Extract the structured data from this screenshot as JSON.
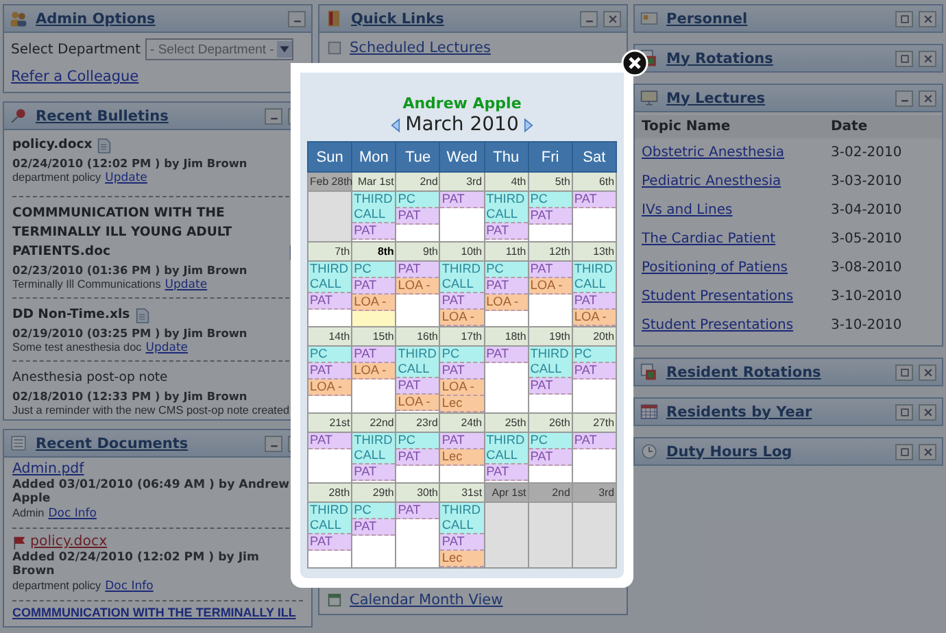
{
  "left": [
    {
      "kind": "admin",
      "title": "Admin Options",
      "expanded": true,
      "closable": false,
      "field_label": "Select Department",
      "select_value": "- Select Department -",
      "link": "Refer a Colleague"
    },
    {
      "kind": "bulletins",
      "title": "Recent Bulletins",
      "expanded": true,
      "closable": true,
      "items": [
        {
          "kind": "file",
          "title": "policy.docx",
          "meta": "02/24/2010 (12:02 PM ) by Jim Brown",
          "desc": "department policy",
          "link": "Update"
        },
        {
          "kind": "file",
          "title": "COMMMUNICATION WITH THE TERMINALLY ILL YOUNG ADULT PATIENTS.doc",
          "meta": "02/23/2010 (01:36 PM ) by Jim Brown",
          "desc": "Terminally Ill Communications",
          "link": "Update"
        },
        {
          "kind": "file",
          "title": "DD Non-Time.xls",
          "meta": "02/19/2010 (03:25 PM ) by Jim Brown",
          "desc": "Some test anesthesia doc",
          "link": "Update"
        },
        {
          "kind": "note",
          "title": "Anesthesia post-op note",
          "meta": "02/18/2010 (12:33 PM ) by Jim Brown",
          "desc": "Just a reminder with the new CMS post-op note created"
        }
      ]
    },
    {
      "kind": "documents",
      "title": "Recent Documents",
      "expanded": true,
      "closable": true,
      "items": [
        {
          "name": "Admin.pdf",
          "flagged": false,
          "meta": "Added 03/01/2010 (06:49 AM ) by Andrew Apple",
          "desc": "Admin",
          "link": "Doc Info"
        },
        {
          "name": "policy.docx",
          "flagged": true,
          "meta": "Added 02/24/2010 (12:02 PM ) by Jim Brown",
          "desc": "department policy",
          "link": "Doc Info"
        },
        {
          "name": "COMMMUNICATION WITH THE TERMINALLY ILL",
          "flagged": false
        }
      ]
    }
  ],
  "middle": [
    {
      "kind": "links",
      "title": "Quick Links",
      "expanded": true,
      "closable": true,
      "items": [
        {
          "label": "Scheduled Lectures"
        },
        {
          "label": "Calendar Month View"
        }
      ]
    }
  ],
  "right": [
    {
      "kind": "plain",
      "title": "Personnel",
      "expanded": false,
      "closable": true
    },
    {
      "kind": "plain",
      "title": "My Rotations",
      "expanded": false,
      "closable": true
    },
    {
      "kind": "lectures",
      "title": "My Lectures",
      "expanded": true,
      "closable": true,
      "columns": [
        "Topic Name",
        "Date"
      ],
      "rows": [
        [
          "Obstetric Anesthesia",
          "3-02-2010"
        ],
        [
          "Pediatric Anesthesia",
          "3-03-2010"
        ],
        [
          "IVs and Lines",
          "3-04-2010"
        ],
        [
          "The Cardiac Patient",
          "3-05-2010"
        ],
        [
          "Positioning of Patiens",
          "3-08-2010"
        ],
        [
          "Student Presentations",
          "3-10-2010"
        ],
        [
          "Student Presentations",
          "3-10-2010"
        ]
      ]
    },
    {
      "kind": "plain",
      "title": "Resident Rotations",
      "expanded": false,
      "closable": true
    },
    {
      "kind": "plain",
      "title": "Residents by Year",
      "expanded": false,
      "closable": true
    },
    {
      "kind": "plain",
      "title": "Duty Hours Log",
      "expanded": false,
      "closable": true
    }
  ],
  "modal": {
    "name": "Andrew Apple",
    "month": "March 2010",
    "weekdays": [
      "Sun",
      "Mon",
      "Tue",
      "Wed",
      "Thu",
      "Fri",
      "Sat"
    ],
    "weeks": [
      {
        "days": [
          {
            "date": "Feb 28th",
            "other_month": true,
            "today": false
          },
          {
            "date": "Mar 1st",
            "other_month": false,
            "today": false,
            "entries": [
              {
                "kind": "call",
                "label": "THIRD CALL"
              },
              {
                "kind": "pat",
                "label": "PAT"
              }
            ]
          },
          {
            "date": "2nd",
            "other_month": false,
            "today": false,
            "entries": [
              {
                "kind": "pc",
                "label": "PC"
              },
              {
                "kind": "pat",
                "label": "PAT"
              }
            ]
          },
          {
            "date": "3rd",
            "other_month": false,
            "today": false,
            "entries": [
              {
                "kind": "pat",
                "label": "PAT"
              }
            ]
          },
          {
            "date": "4th",
            "other_month": false,
            "today": false,
            "entries": [
              {
                "kind": "call",
                "label": "THIRD CALL"
              },
              {
                "kind": "pat",
                "label": "PAT"
              }
            ]
          },
          {
            "date": "5th",
            "other_month": false,
            "today": false,
            "entries": [
              {
                "kind": "pc",
                "label": "PC"
              },
              {
                "kind": "pat",
                "label": "PAT"
              }
            ]
          },
          {
            "date": "6th",
            "other_month": false,
            "today": false,
            "entries": [
              {
                "kind": "pat",
                "label": "PAT"
              }
            ]
          }
        ]
      },
      {
        "days": [
          {
            "date": "7th",
            "other_month": false,
            "today": false,
            "entries": [
              {
                "kind": "call",
                "label": "THIRD CALL"
              },
              {
                "kind": "pat",
                "label": "PAT"
              }
            ]
          },
          {
            "date": "8th",
            "other_month": false,
            "today": true,
            "entries": [
              {
                "kind": "pc",
                "label": "PC"
              },
              {
                "kind": "pat",
                "label": "PAT"
              },
              {
                "kind": "loa",
                "label": "LOA -"
              }
            ]
          },
          {
            "date": "9th",
            "other_month": false,
            "today": false,
            "entries": [
              {
                "kind": "pat",
                "label": "PAT"
              },
              {
                "kind": "loa",
                "label": "LOA -"
              }
            ]
          },
          {
            "date": "10th",
            "other_month": false,
            "today": false,
            "entries": [
              {
                "kind": "call",
                "label": "THIRD CALL"
              },
              {
                "kind": "pat",
                "label": "PAT"
              },
              {
                "kind": "loa",
                "label": "LOA -"
              }
            ]
          },
          {
            "date": "11th",
            "other_month": false,
            "today": false,
            "entries": [
              {
                "kind": "pc",
                "label": "PC"
              },
              {
                "kind": "pat",
                "label": "PAT"
              },
              {
                "kind": "loa",
                "label": "LOA -"
              }
            ]
          },
          {
            "date": "12th",
            "other_month": false,
            "today": false,
            "entries": [
              {
                "kind": "pat",
                "label": "PAT"
              },
              {
                "kind": "loa",
                "label": "LOA -"
              }
            ]
          },
          {
            "date": "13th",
            "other_month": false,
            "today": false,
            "entries": [
              {
                "kind": "call",
                "label": "THIRD CALL"
              },
              {
                "kind": "pat",
                "label": "PAT"
              },
              {
                "kind": "loa",
                "label": "LOA -"
              }
            ]
          }
        ]
      },
      {
        "days": [
          {
            "date": "14th",
            "other_month": false,
            "today": false,
            "entries": [
              {
                "kind": "pc",
                "label": "PC"
              },
              {
                "kind": "pat",
                "label": "PAT"
              },
              {
                "kind": "loa",
                "label": "LOA -"
              }
            ]
          },
          {
            "date": "15th",
            "other_month": false,
            "today": false,
            "entries": [
              {
                "kind": "pat",
                "label": "PAT"
              },
              {
                "kind": "loa",
                "label": "LOA -"
              }
            ]
          },
          {
            "date": "16th",
            "other_month": false,
            "today": false,
            "entries": [
              {
                "kind": "call",
                "label": "THIRD CALL"
              },
              {
                "kind": "pat",
                "label": "PAT"
              },
              {
                "kind": "loa",
                "label": "LOA -"
              }
            ]
          },
          {
            "date": "17th",
            "other_month": false,
            "today": false,
            "entries": [
              {
                "kind": "pc",
                "label": "PC"
              },
              {
                "kind": "pat",
                "label": "PAT"
              },
              {
                "kind": "loa",
                "label": "LOA -"
              },
              {
                "kind": "lec",
                "label": "Lec"
              }
            ]
          },
          {
            "date": "18th",
            "other_month": false,
            "today": false,
            "entries": [
              {
                "kind": "pat",
                "label": "PAT"
              }
            ]
          },
          {
            "date": "19th",
            "other_month": false,
            "today": false,
            "entries": [
              {
                "kind": "call",
                "label": "THIRD CALL"
              },
              {
                "kind": "pat",
                "label": "PAT"
              }
            ]
          },
          {
            "date": "20th",
            "other_month": false,
            "today": false,
            "entries": [
              {
                "kind": "pc",
                "label": "PC"
              },
              {
                "kind": "pat",
                "label": "PAT"
              }
            ]
          }
        ]
      },
      {
        "days": [
          {
            "date": "21st",
            "other_month": false,
            "today": false,
            "entries": [
              {
                "kind": "pat",
                "label": "PAT"
              }
            ]
          },
          {
            "date": "22nd",
            "other_month": false,
            "today": false,
            "entries": [
              {
                "kind": "call",
                "label": "THIRD CALL"
              },
              {
                "kind": "pat",
                "label": "PAT"
              }
            ]
          },
          {
            "date": "23rd",
            "other_month": false,
            "today": false,
            "entries": [
              {
                "kind": "pc",
                "label": "PC"
              },
              {
                "kind": "pat",
                "label": "PAT"
              }
            ]
          },
          {
            "date": "24th",
            "other_month": false,
            "today": false,
            "entries": [
              {
                "kind": "pat",
                "label": "PAT"
              },
              {
                "kind": "lec",
                "label": "Lec"
              }
            ]
          },
          {
            "date": "25th",
            "other_month": false,
            "today": false,
            "entries": [
              {
                "kind": "call",
                "label": "THIRD CALL"
              },
              {
                "kind": "pat",
                "label": "PAT"
              }
            ]
          },
          {
            "date": "26th",
            "other_month": false,
            "today": false,
            "entries": [
              {
                "kind": "pc",
                "label": "PC"
              },
              {
                "kind": "pat",
                "label": "PAT"
              }
            ]
          },
          {
            "date": "27th",
            "other_month": false,
            "today": false,
            "entries": [
              {
                "kind": "pat",
                "label": "PAT"
              }
            ]
          }
        ]
      },
      {
        "days": [
          {
            "date": "28th",
            "other_month": false,
            "today": false,
            "entries": [
              {
                "kind": "call",
                "label": "THIRD CALL"
              },
              {
                "kind": "pat",
                "label": "PAT"
              }
            ]
          },
          {
            "date": "29th",
            "other_month": false,
            "today": false,
            "entries": [
              {
                "kind": "pc",
                "label": "PC"
              },
              {
                "kind": "pat",
                "label": "PAT"
              }
            ]
          },
          {
            "date": "30th",
            "other_month": false,
            "today": false,
            "entries": [
              {
                "kind": "pat",
                "label": "PAT"
              }
            ]
          },
          {
            "date": "31st",
            "other_month": false,
            "today": false,
            "entries": [
              {
                "kind": "call",
                "label": "THIRD CALL"
              },
              {
                "kind": "pat",
                "label": "PAT"
              },
              {
                "kind": "lec",
                "label": "Lec"
              }
            ]
          },
          {
            "date": "Apr 1st",
            "other_month": true,
            "today": false
          },
          {
            "date": "2nd",
            "other_month": true,
            "today": false
          },
          {
            "date": "3rd",
            "other_month": true,
            "today": false
          }
        ]
      }
    ]
  }
}
